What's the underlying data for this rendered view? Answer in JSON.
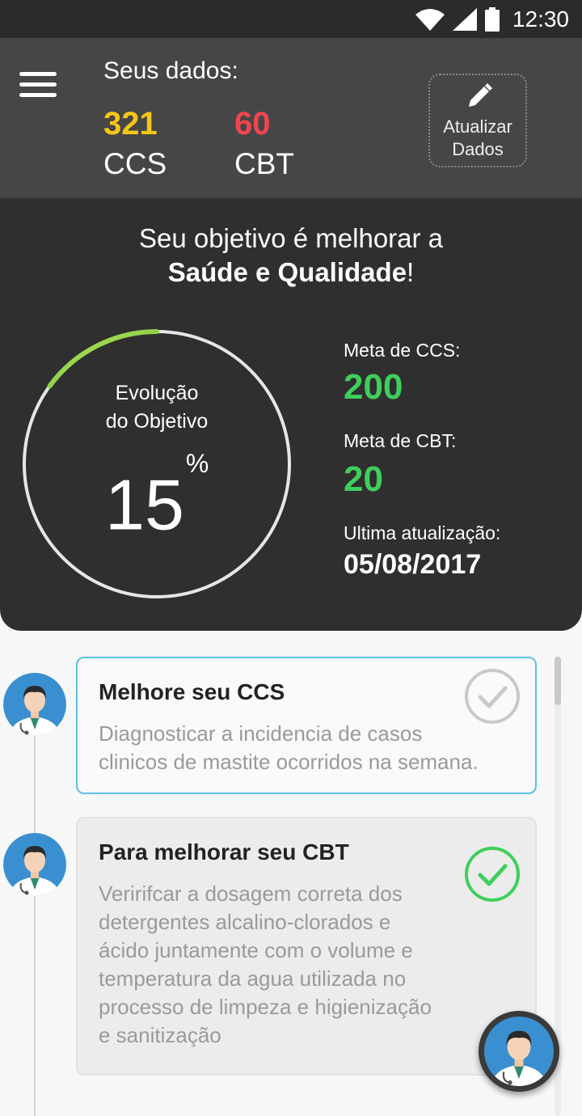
{
  "status": {
    "time": "12:30"
  },
  "header": {
    "title": "Seus dados:",
    "ccs_value": "321",
    "ccs_label": "CCS",
    "cbt_value": "60",
    "cbt_label": "CBT",
    "update_label_line1": "Atualizar",
    "update_label_line2": "Dados",
    "colors": {
      "ccs": "#f5c518",
      "cbt": "#f0454f"
    }
  },
  "hero": {
    "title_line1": "Seu objetivo é melhorar a",
    "title_bold": "Saúde e Qualidade",
    "title_end": "!",
    "progress_label_line1": "Evolução",
    "progress_label_line2": "do Objetivo",
    "progress_value": "15",
    "progress_unit": "%",
    "progress_fraction": 0.15,
    "meta_ccs_label": "Meta de CCS:",
    "meta_ccs_value": "200",
    "meta_cbt_label": "Meta de CBT:",
    "meta_cbt_value": "20",
    "last_update_label": "Ultima atualização:",
    "last_update_value": "05/08/2017"
  },
  "tasks": [
    {
      "title": "Melhore seu CCS",
      "desc_lines": [
        "Diagnosticar a incidencia de casos",
        "clinicos de mastite ocorridos na semana."
      ],
      "done": false
    },
    {
      "title": "Para melhorar seu CBT",
      "desc_lines": [
        "Veririfcar a dosagem correta dos",
        "detergentes alcalino-clorados e",
        "ácido juntamente com o volume e",
        "temperatura da agua utilizada no",
        "processo de limpeza e higienização",
        "e sanitização"
      ],
      "done": true
    }
  ],
  "icons": {
    "menu": "menu-icon",
    "edit": "pencil-icon",
    "wifi": "wifi-icon",
    "signal": "signal-icon",
    "battery": "battery-icon",
    "check": "check-circle-icon",
    "doctor": "doctor-avatar-icon"
  }
}
